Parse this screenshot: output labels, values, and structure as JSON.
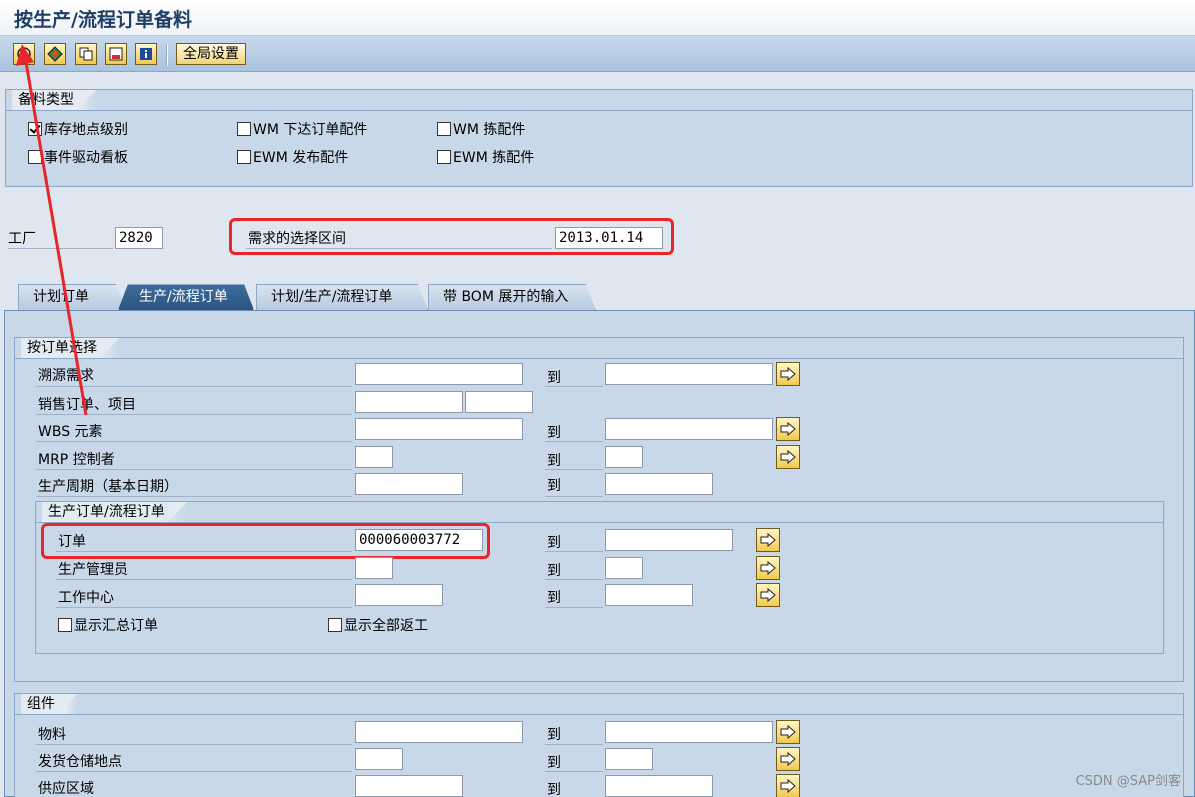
{
  "window": {
    "title": "按生产/流程订单备料"
  },
  "toolbar": {
    "buttons": [
      {
        "name": "execute-icon"
      },
      {
        "name": "variant-icon"
      },
      {
        "name": "copy-icon"
      },
      {
        "name": "save-variant-icon"
      },
      {
        "name": "info-icon"
      }
    ],
    "global_settings_label": "全局设置"
  },
  "staging_type": {
    "title": "备料类型",
    "options": [
      {
        "label": "库存地点级别",
        "checked": true
      },
      {
        "label": "事件驱动看板",
        "checked": false
      },
      {
        "label": "WM 下达订单配件",
        "checked": false
      },
      {
        "label": "EWM 发布配件",
        "checked": false
      },
      {
        "label": "WM 拣配件",
        "checked": false
      },
      {
        "label": "EWM 拣配件",
        "checked": false
      }
    ]
  },
  "plant": {
    "label": "工厂",
    "value": "2820"
  },
  "requirement_interval": {
    "label": "需求的选择区间",
    "value": "2013.01.14"
  },
  "tabs": [
    {
      "label": "计划订单",
      "active": false
    },
    {
      "label": "生产/流程订单",
      "active": true
    },
    {
      "label": "计划/生产/流程订单",
      "active": false
    },
    {
      "label": "带 BOM 展开的输入",
      "active": false
    }
  ],
  "order_selection": {
    "title": "按订单选择",
    "to_label": "到",
    "rows": [
      {
        "label": "溯源需求",
        "from": "",
        "to": ""
      },
      {
        "label": "销售订单、项目",
        "from": "",
        "item": ""
      },
      {
        "label": "WBS 元素",
        "from": "",
        "to": ""
      },
      {
        "label": "MRP 控制者",
        "from": "",
        "to": ""
      },
      {
        "label": "生产周期（基本日期）",
        "from": "",
        "to": ""
      }
    ],
    "production": {
      "title": "生产订单/流程订单",
      "rows": [
        {
          "label": "订单",
          "from": "000060003772",
          "to": ""
        },
        {
          "label": "生产管理员",
          "from": "",
          "to": ""
        },
        {
          "label": "工作中心",
          "from": "",
          "to": ""
        }
      ],
      "show_collective_label": "显示汇总订单",
      "show_rework_label": "显示全部返工"
    }
  },
  "components": {
    "title": "组件",
    "rows": [
      {
        "label": "物料",
        "from": "",
        "to": ""
      },
      {
        "label": "发货仓储地点",
        "from": "",
        "to": ""
      },
      {
        "label": "供应区域",
        "from": "",
        "to": ""
      }
    ]
  },
  "watermark": "CSDN @SAP剑客"
}
